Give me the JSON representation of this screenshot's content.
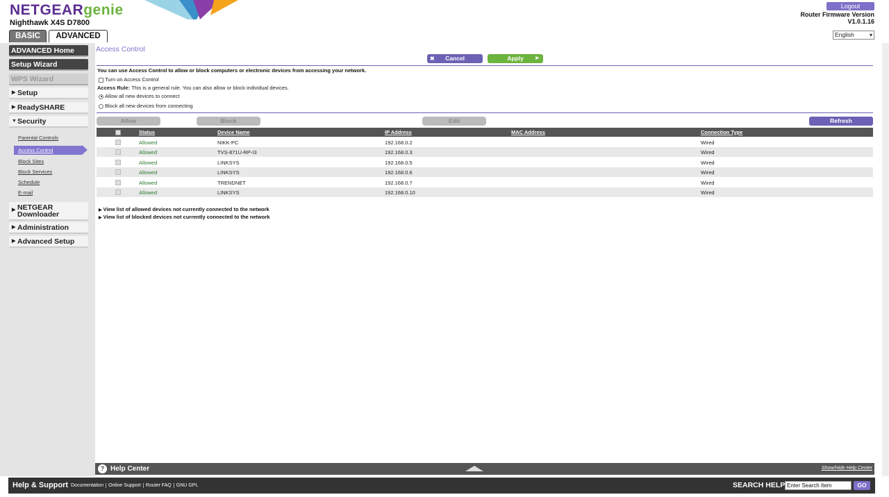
{
  "header": {
    "logo_netgear": "NETGEAR",
    "logo_genie": "genie",
    "model": "Nighthawk X4S D7800",
    "tabs": {
      "basic": "BASIC",
      "advanced": "ADVANCED"
    },
    "logout": "Logout",
    "firmware_label": "Router Firmware Version",
    "firmware_version": "V1.0.1.16",
    "language": "English"
  },
  "sidebar": {
    "advanced_home": "ADVANCED Home",
    "setup_wizard": "Setup Wizard",
    "wps_wizard": "WPS Wizard",
    "setup": "Setup",
    "readyshare": "ReadySHARE",
    "security": "Security",
    "security_links": [
      "Parental Controls",
      "Access Control",
      "Block Sites",
      "Block Services",
      "Schedule",
      "E-mail"
    ],
    "netgear_downloader_line1": "NETGEAR",
    "netgear_downloader_line2": "Downloader",
    "administration": "Administration",
    "advanced_setup": "Advanced Setup"
  },
  "main": {
    "title": "Access Control",
    "cancel": "Cancel",
    "apply": "Apply",
    "description": "You can use Access Control to allow or block computers or electronic devices from accessing your network.",
    "turn_on_label": "Turn on Access Control",
    "rule_label": "Access Rule:",
    "rule_text": "This is a general rule. You can also allow or block individual devices.",
    "radio_allow": "Allow all new devices to connect",
    "radio_block": "Block all new devices from connecting",
    "buttons": {
      "allow": "Allow",
      "block": "Block",
      "edit": "Edit",
      "refresh": "Refresh"
    },
    "columns": {
      "status": "Status",
      "device_name": "Device Name",
      "ip": "IP Address",
      "mac": "MAC Address",
      "connection": "Connection Type"
    },
    "rows": [
      {
        "status": "Allowed",
        "name": "NIKK-PC",
        "ip": "192.168.0.2",
        "mac": "",
        "conn": "Wired"
      },
      {
        "status": "Allowed",
        "name": "TVS-871U-RP-I3",
        "ip": "192.168.0.3",
        "mac": "",
        "conn": "Wired"
      },
      {
        "status": "Allowed",
        "name": "LINKSYS",
        "ip": "192.168.0.5",
        "mac": "",
        "conn": "Wired"
      },
      {
        "status": "Allowed",
        "name": "LINKSYS",
        "ip": "192.168.0.6",
        "mac": "",
        "conn": "Wired"
      },
      {
        "status": "Allowed",
        "name": "TRENDNET",
        "ip": "192.168.0.7",
        "mac": "",
        "conn": "Wired"
      },
      {
        "status": "Allowed",
        "name": "LINKSYS",
        "ip": "192.168.0.10",
        "mac": "",
        "conn": "Wired"
      }
    ],
    "view_allowed": "View list of allowed devices not currently connected to the network",
    "view_blocked": "View list of blocked devices not currently connected to the network"
  },
  "helpbar": {
    "title": "Help Center",
    "toggle": "Show/Hide Help Center"
  },
  "footer": {
    "title": "Help & Support",
    "links": [
      "Documentation",
      "Online Support",
      "Router FAQ",
      "GNU GPL"
    ],
    "search_label": "SEARCH HELP",
    "search_value": "Enter Search Item",
    "go": "GO"
  },
  "colors": {
    "accent": "#6b62b5",
    "apply": "#6cb33f",
    "status_allowed": "#2e7d32"
  }
}
